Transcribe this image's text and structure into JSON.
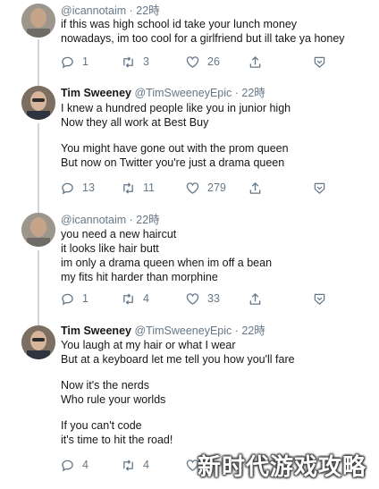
{
  "tweets": [
    {
      "name": "",
      "handle": "@icannotaim",
      "time": "22時",
      "lines": [
        "if this was high school id take your lunch money",
        "nowadays, im too cool for a girlfriend but ill take ya honey"
      ],
      "replies": "1",
      "retweets": "3",
      "likes": "26"
    },
    {
      "name": "Tim Sweeney",
      "handle": "@TimSweeneyEpic",
      "time": "22時",
      "lines": [
        "I knew a hundred people like you in junior high",
        "Now they all work at Best Buy",
        "",
        "You might have gone out with the prom queen",
        "But now on Twitter you're just a drama queen"
      ],
      "replies": "13",
      "retweets": "11",
      "likes": "279"
    },
    {
      "name": "",
      "handle": "@icannotaim",
      "time": "22時",
      "lines": [
        "you need a new haircut",
        "it looks like hair butt",
        "im only a drama queen when im off a bean",
        "my fits hit harder than morphine"
      ],
      "replies": "1",
      "retweets": "4",
      "likes": "33"
    },
    {
      "name": "Tim Sweeney",
      "handle": "@TimSweeneyEpic",
      "time": "22時",
      "lines": [
        "You laugh at my hair or what I wear",
        "But at a keyboard let me tell you how you'll fare",
        "",
        "Now it's the nerds",
        "Who rule your worlds",
        "",
        "If you can't code",
        "it's time to hit the road!"
      ],
      "replies": "4",
      "retweets": "4",
      "likes": ""
    }
  ],
  "separator": "·",
  "watermark": "新时代游戏攻略",
  "icons": [
    "reply-icon",
    "retweet-icon",
    "like-icon",
    "share-icon",
    "caret-icon"
  ],
  "colors": {
    "text": "#14171a",
    "secondary": "#657786",
    "thread_line": "#ccd6dd"
  }
}
